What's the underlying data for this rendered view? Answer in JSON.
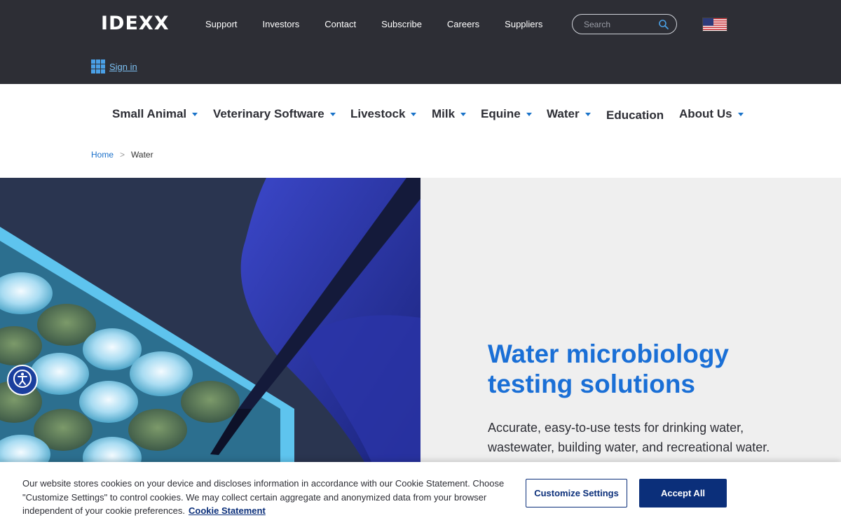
{
  "brand": {
    "logo_text": "IDEXX"
  },
  "utility_nav": [
    "Support",
    "Investors",
    "Contact",
    "Subscribe",
    "Careers",
    "Suppliers"
  ],
  "search": {
    "placeholder": "Search",
    "icon": "search-icon"
  },
  "locale": {
    "icon": "us-flag-icon"
  },
  "signin": {
    "label": "Sign in",
    "icon": "grid-icon"
  },
  "main_nav": [
    {
      "label": "Small Animal",
      "has_dropdown": true
    },
    {
      "label": "Veterinary Software",
      "has_dropdown": true
    },
    {
      "label": "Livestock",
      "has_dropdown": true
    },
    {
      "label": "Milk",
      "has_dropdown": true
    },
    {
      "label": "Equine",
      "has_dropdown": true
    },
    {
      "label": "Water",
      "has_dropdown": true
    },
    {
      "label": "Education",
      "has_dropdown": false
    },
    {
      "label": "About Us",
      "has_dropdown": true
    }
  ],
  "breadcrumb": {
    "home": "Home",
    "separator": ">",
    "current": "Water"
  },
  "hero": {
    "title": "Water microbiology testing solutions",
    "description": "Accurate, easy-to-use tests for drinking water, wastewater, building water, and recreational water."
  },
  "accessibility": {
    "icon": "accessibility-icon"
  },
  "cookie_banner": {
    "text": "Our website stores cookies on your device and discloses information in accordance with our Cookie Statement. Choose \"Customize Settings\" to control cookies. We may collect certain aggregate and anonymized data from your browser independent of your cookie preferences.",
    "link_label": "Cookie Statement",
    "customize_label": "Customize Settings",
    "accept_label": "Accept All"
  },
  "colors": {
    "topbar": "#2d2e35",
    "accent": "#1a6fd6",
    "cookie_button": "#0b2f7a"
  }
}
